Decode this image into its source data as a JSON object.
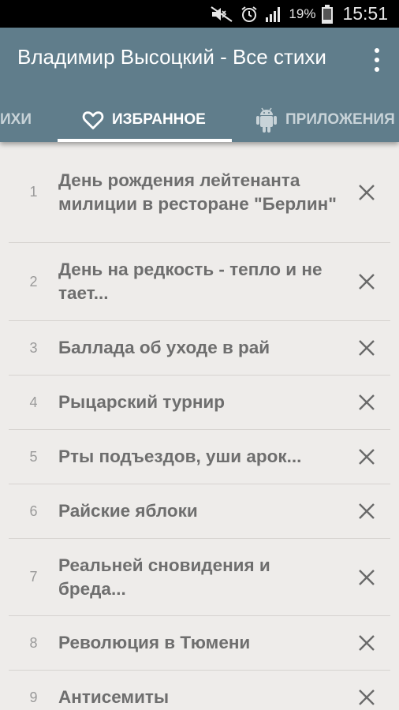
{
  "status_bar": {
    "battery_percent": "19%",
    "time": "15:51",
    "icons": [
      "mute-icon",
      "alarm-icon",
      "signal-icon",
      "battery-icon"
    ]
  },
  "app_bar": {
    "title": "Владимир Высоцкий - Все стихи",
    "overflow_icon": "more-vert-icon"
  },
  "tabs": [
    {
      "label": "СТИХИ",
      "visible_label": "ИХИ",
      "selected": false
    },
    {
      "label": "ИЗБРАННОЕ",
      "icon": "heart-icon",
      "selected": true
    },
    {
      "label": "ПРИЛОЖЕНИЯ",
      "icon": "android-icon",
      "selected": false
    }
  ],
  "favorites": [
    {
      "num": "1",
      "title": "День рождения лейтенанта милиции в ресторане \"Берлин\""
    },
    {
      "num": "2",
      "title": "День на редкость - тепло и не тает..."
    },
    {
      "num": "3",
      "title": "Баллада об уходе в рай"
    },
    {
      "num": "4",
      "title": "Рыцарский турнир"
    },
    {
      "num": "5",
      "title": "Рты подъездов, уши арок..."
    },
    {
      "num": "6",
      "title": "Райские яблоки"
    },
    {
      "num": "7",
      "title": "Реальней сновидения и бреда..."
    },
    {
      "num": "8",
      "title": "Революция в Тюмени"
    },
    {
      "num": "9",
      "title": "Антисемиты"
    }
  ],
  "colors": {
    "app_bar": "#607d8b",
    "background": "#eeecea",
    "text": "#6e6e6e"
  }
}
